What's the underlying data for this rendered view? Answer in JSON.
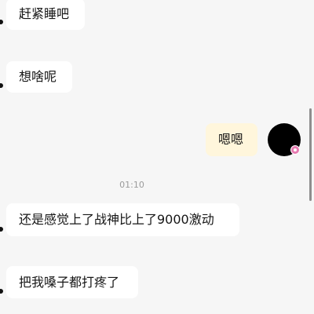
{
  "messages": [
    {
      "text": "赶紧睡吧",
      "direction": "incoming"
    },
    {
      "text": "想啥呢",
      "direction": "incoming"
    },
    {
      "text": "嗯嗯",
      "direction": "outgoing"
    },
    {
      "text": "还是感觉上了战神比上了9000激动",
      "direction": "incoming"
    },
    {
      "text": "把我嗓子都打疼了",
      "direction": "incoming"
    }
  ],
  "timestamp": "01:10",
  "colors": {
    "background": "#f6f6f6",
    "incoming_bubble": "#ffffff",
    "outgoing_bubble": "#fff6dc",
    "avatar": "#000000",
    "avatar_badge": "#e77ab0"
  }
}
